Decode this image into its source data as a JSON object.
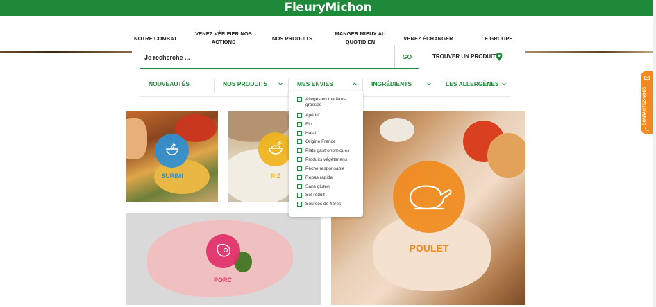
{
  "brand": {
    "logo_text": "FleuryMichon",
    "green": "#1f8a3a",
    "red": "#d8202a",
    "orange": "#f08a1c"
  },
  "nav": {
    "items": [
      {
        "label": "NOTRE COMBAT"
      },
      {
        "label": "VENEZ VÉRIFIER NOS ACTIONS"
      },
      {
        "label": "NOS PRODUITS"
      },
      {
        "label": "MANGER MIEUX AU QUOTIDIEN"
      },
      {
        "label": "VENEZ ÉCHANGER"
      },
      {
        "label": "LE GROUPE"
      }
    ]
  },
  "search": {
    "placeholder": "Je recherche ...",
    "value": "",
    "go_label": "GO",
    "find_product_label": "TROUVER UN PRODUIT",
    "find_product_icon": "location-pin-icon"
  },
  "filters": [
    {
      "label": "NOUVEAUTÉS",
      "has_chevron": false
    },
    {
      "label": "NOS PRODUITS",
      "has_chevron": true,
      "icon": "chevron-down-icon"
    },
    {
      "label": "MES ENVIES",
      "has_chevron": true,
      "icon": "chevron-up-icon",
      "open": true
    },
    {
      "label": "INGRÉDIENTS",
      "has_chevron": true,
      "icon": "chevron-down-icon"
    },
    {
      "label": "LES ALLERGÈNES",
      "has_chevron": true,
      "icon": "chevron-down-icon"
    }
  ],
  "envies_options": [
    "Allégés en matières grasses",
    "Apéritif",
    "Bio",
    "Halal",
    "Origine France",
    "Plats gastronomiques",
    "Produits végétariens",
    "Pêche responsable",
    "Repas rapide",
    "Sans gluten",
    "Sel réduit",
    "Sources de fibres"
  ],
  "tiles": {
    "surimi": {
      "label": "SURIMI",
      "color": "#2f8fd1",
      "icon": "surimi-bowl-icon"
    },
    "riz": {
      "label": "RIZ",
      "color": "#f0b41c",
      "icon": "rice-bowl-icon"
    },
    "poulet": {
      "label": "POULET",
      "color": "#f08a1c",
      "icon": "chicken-icon"
    },
    "jambon": {
      "label": "PORC",
      "color": "#e0306a",
      "icon": "ham-icon"
    }
  },
  "contact_tab": {
    "label": "CONTACTEZ-NOUS",
    "icons": [
      "envelope-icon",
      "phone-icon"
    ]
  }
}
